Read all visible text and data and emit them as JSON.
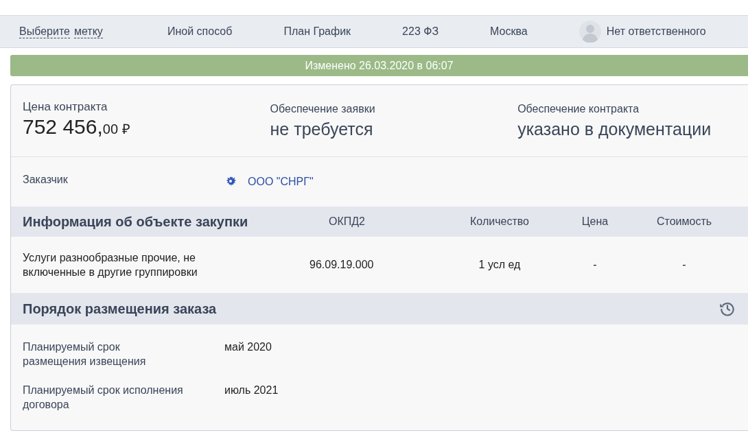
{
  "top_bar": {
    "tag_picker": [
      "Выберите",
      "метку"
    ],
    "items": [
      "Иной способ",
      "План График",
      "223 ФЗ",
      "Москва"
    ],
    "responsible": "Нет ответственного"
  },
  "banner": "Изменено 26.03.2020 в 06:07",
  "summary": [
    {
      "label": "Цена контракта",
      "kind": "price",
      "whole": "752 456,",
      "fraction": "00 ₽"
    },
    {
      "label": "Обеспечение заявки",
      "kind": "text",
      "value": "не требуется"
    },
    {
      "label": "Обеспечение контракта",
      "kind": "text",
      "value": "указано в документации"
    }
  ],
  "customer": {
    "label": "Заказчик",
    "name": "ООО \"СНРГ\""
  },
  "purchase_table": {
    "title": "Информация об объекте закупки",
    "columns": [
      "ОКПД2",
      "Количество",
      "Цена",
      "Стоимость"
    ],
    "rows": [
      {
        "name": "Услуги разнообразные прочие, не включенные в другие группировки",
        "cells": [
          "96.09.19.000",
          "1 усл ед",
          "-",
          "-"
        ]
      }
    ]
  },
  "order_section": {
    "title": "Порядок размещения заказа",
    "fields": [
      {
        "label": "Планируемый срок размещения извещения",
        "value": "май 2020"
      },
      {
        "label": "Планируемый срок исполнения договора",
        "value": "июль 2021"
      }
    ]
  }
}
